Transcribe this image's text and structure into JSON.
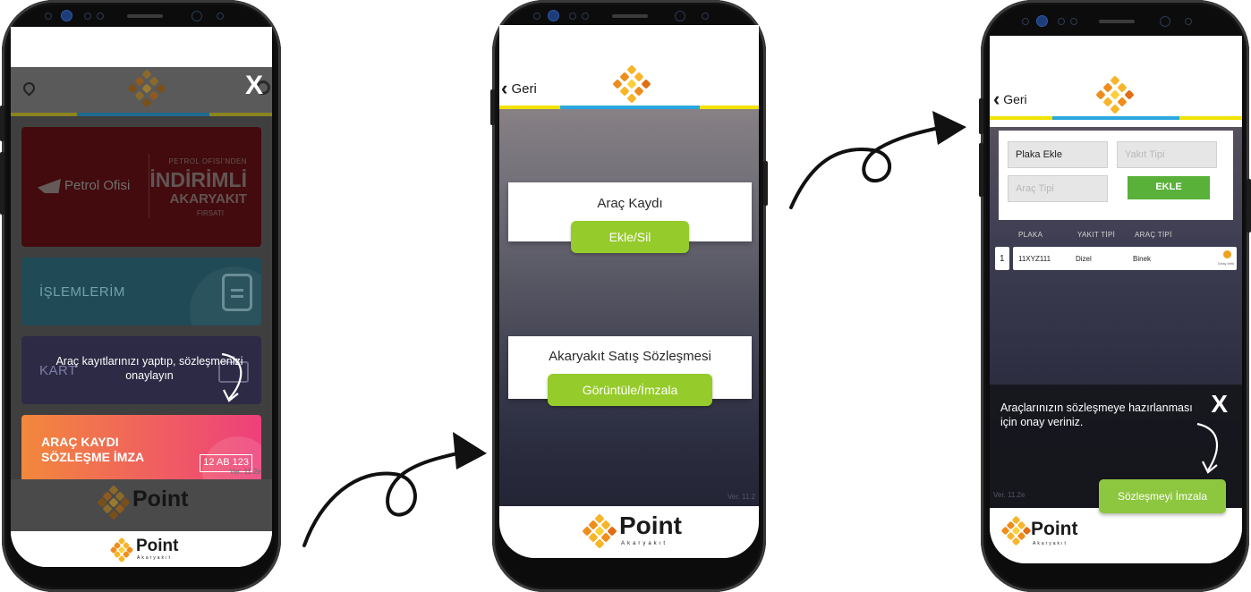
{
  "screen1": {
    "petrol_ofisi": "Petrol Ofisi",
    "promo_small": "PETROL OFİSİ'NDEN",
    "promo_big": "İNDİRİMLİ",
    "promo_mid": "AKARYAKIT",
    "promo_tiny": "FIRSATI",
    "islemlerim": "İŞLEMLERİM",
    "kart_label": "KART",
    "tooltip": "Araç kayıtlarınızı yaptıp, sözleşmenizi onaylayın",
    "arac_line1": "ARAÇ KAYDI",
    "arac_line2": "SÖZLEŞME İMZA",
    "plate": "12 AB 123",
    "version": "Ver. 11.2e",
    "close": "X",
    "brand": "Point",
    "brand_sub": "Akaryakıt"
  },
  "screen2": {
    "back": "Geri",
    "card1_title": "Araç Kaydı",
    "card1_button": "Ekle/Sil",
    "card2_title": "Akaryakıt Satış Sözleşmesi",
    "card2_button": "Görüntüle/İmzala",
    "version": "Ver. 11.2",
    "brand": "Point",
    "brand_sub": "Akaryakıt"
  },
  "screen3": {
    "back": "Geri",
    "plaka_value": "Plaka Ekle",
    "yakit_placeholder": "Yakıt Tipi",
    "arac_placeholder": "Araç Tipi",
    "ekle": "EKLE",
    "headers": [
      "PLAKA",
      "YAKIT TİPİ",
      "ARAÇ TİPİ"
    ],
    "row": {
      "index": "1",
      "plaka": "11XYZ111",
      "yakit": "Dizel",
      "arac": "Binek",
      "status": "Onay bekl."
    },
    "tooltip": "Araçlarınızın sözleşmeye hazırlanması için onay veriniz.",
    "close": "X",
    "sign_button": "Sözleşmeyi İmzala",
    "version": "Ver. 11.2e",
    "brand": "Point",
    "brand_sub": "Akaryakıt"
  },
  "colors": {
    "accent_green": "#95cb2a",
    "strip_yellow": "#f2e200",
    "strip_blue": "#2aa7e0",
    "logo_orange": "#f5a21b"
  }
}
